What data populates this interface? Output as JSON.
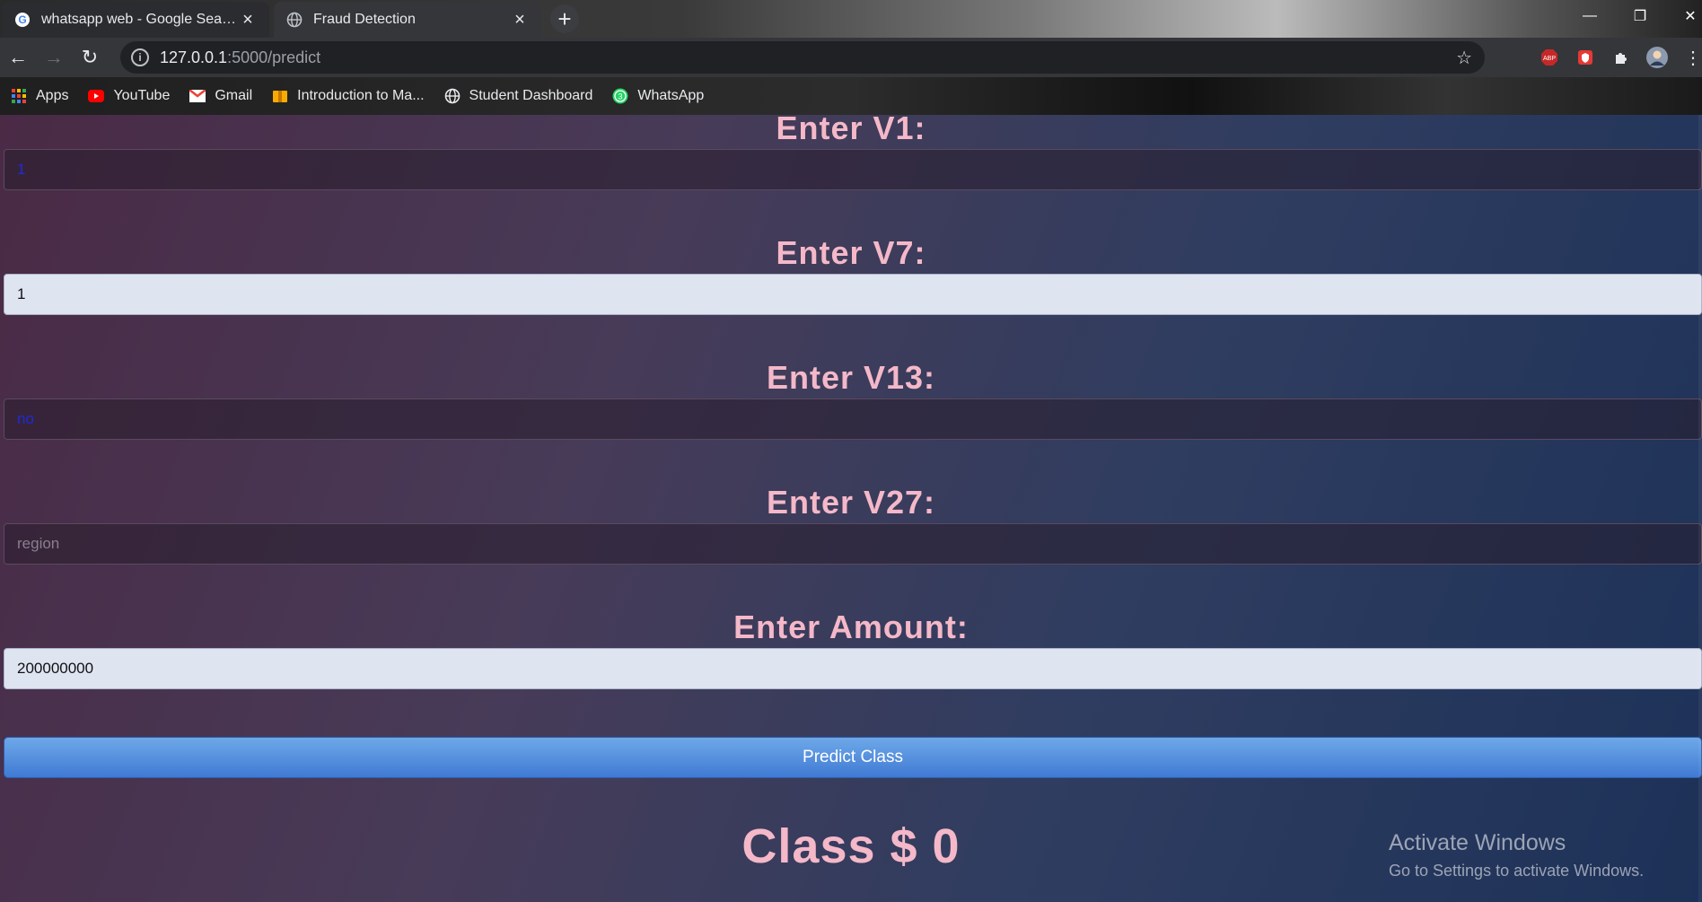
{
  "browser": {
    "tabs": [
      {
        "title": "whatsapp web - Google Search",
        "active": false,
        "icon": "google-icon"
      },
      {
        "title": "Fraud Detection",
        "active": true,
        "icon": "globe-icon"
      }
    ],
    "url_host": "127.0.0.1",
    "url_path": ":5000/predict",
    "bookmarks": [
      {
        "label": "Apps",
        "icon": "apps-grid-icon"
      },
      {
        "label": "YouTube",
        "icon": "youtube-icon"
      },
      {
        "label": "Gmail",
        "icon": "gmail-icon"
      },
      {
        "label": "Introduction to Ma...",
        "icon": "folder-icon"
      },
      {
        "label": "Student Dashboard",
        "icon": "globe-icon"
      },
      {
        "label": "WhatsApp",
        "icon": "whatsapp-icon"
      }
    ]
  },
  "form": {
    "v1": {
      "label": "Enter V1:",
      "value": "1"
    },
    "v7": {
      "label": "Enter V7:",
      "value": "1"
    },
    "v13": {
      "label": "Enter V13:",
      "value": "no"
    },
    "v27": {
      "label": "Enter V27:",
      "value": "",
      "placeholder": "region"
    },
    "amount": {
      "label": "Enter Amount:",
      "value": "200000000"
    },
    "submit_label": "Predict Class"
  },
  "result": {
    "text": "Class $ 0"
  },
  "watermark": {
    "title": "Activate Windows",
    "subtitle": "Go to Settings to activate Windows."
  }
}
